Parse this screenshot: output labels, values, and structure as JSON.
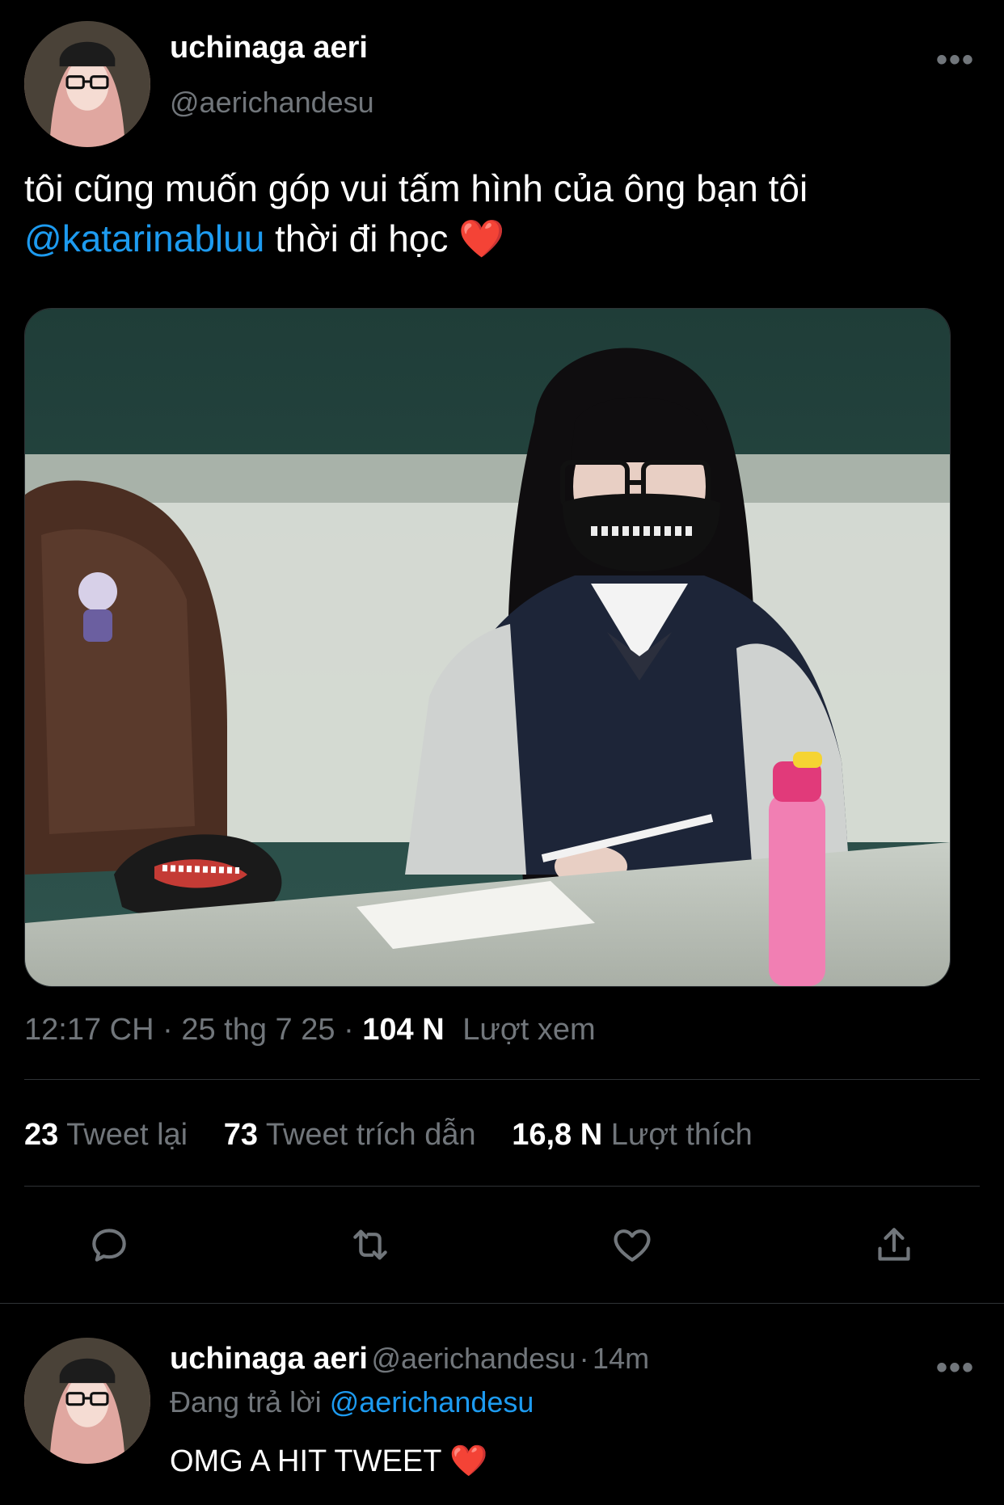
{
  "tweet": {
    "author_name": "uchinaga aeri",
    "author_handle": "@aerichandesu",
    "text_line1": "tôi cũng muốn góp vui tấm hình của ông bạn tôi",
    "mention": "@katarinabluu",
    "text_after_mention": " thời đi học ",
    "heart": "❤️",
    "time": "12:17 CH",
    "date": "25 thg 7 25",
    "views_count": "104 N",
    "views_label": "Lượt xem",
    "retweets_count": "23",
    "retweets_label": "Tweet lại",
    "quotes_count": "73",
    "quotes_label": "Tweet trích dẫn",
    "likes_count": "16,8 N",
    "likes_label": "Lượt thích",
    "more_icon": "more-icon"
  },
  "actions": {
    "reply_icon": "reply-icon",
    "retweet_icon": "retweet-icon",
    "like_icon": "heart-icon",
    "share_icon": "share-icon"
  },
  "reply": {
    "author_name": "uchinaga aeri",
    "author_handle": "@aerichandesu",
    "time_sep": "·",
    "time": "14m",
    "replying_label": "Đang trả lời",
    "replying_to": "@aerichandesu",
    "text": "OMG A HIT TWEET",
    "heart": "❤️"
  },
  "colors": {
    "background": "#000000",
    "text": "#ffffff",
    "secondary": "#71767b",
    "accent": "#1d9bf0",
    "divider": "#2f3336"
  }
}
